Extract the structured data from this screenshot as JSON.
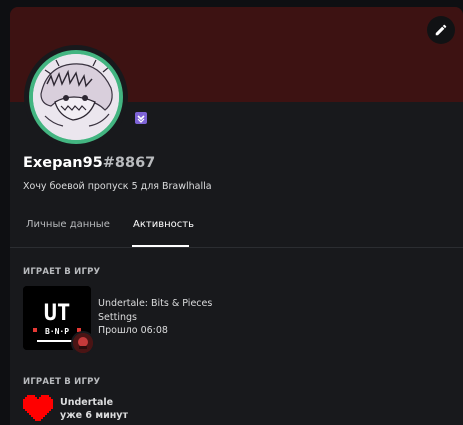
{
  "profile": {
    "username": "Exepan95",
    "discriminator": "#8867",
    "custom_status": "Хочу боевой пропуск 5 для Brawlhalla",
    "badge_icon": "hypesquad-badge-icon",
    "status_color": "#43b581",
    "banner_color": "#3d1212"
  },
  "tabs": [
    {
      "label": "Личные данные",
      "active": false
    },
    {
      "label": "Активность",
      "active": true
    }
  ],
  "activities": [
    {
      "header": "ИГРАЕТ В ИГРУ",
      "name": "Undertale: Bits & Pieces",
      "details": "Settings",
      "elapsed": "Прошло 06:08",
      "art_text": "UT",
      "art_subtext": "B·N·P"
    },
    {
      "header": "ИГРАЕТ В ИГРУ",
      "name": "Undertale",
      "elapsed": "уже 6 минут",
      "icon": "red-heart-icon"
    }
  ]
}
